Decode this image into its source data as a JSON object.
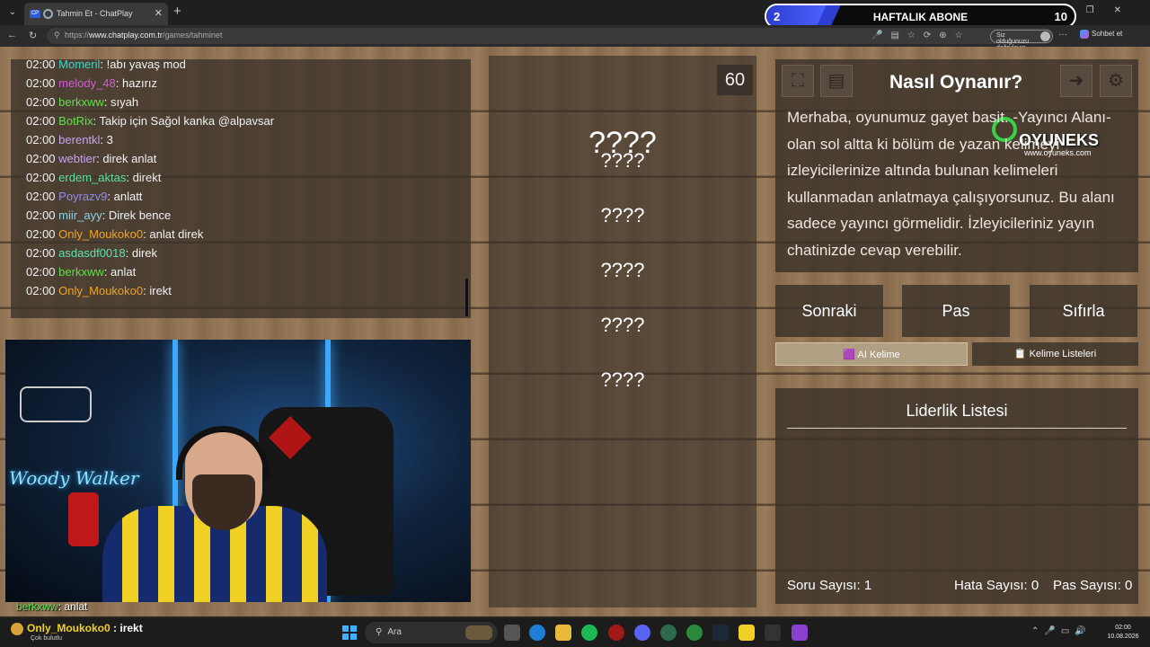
{
  "browser": {
    "tab_title": "Tahmin Et - ChatPlay",
    "url_prefix": "https://",
    "url_domain": "www.chatplay.com.tr",
    "url_path": "/games/tahminet",
    "verify_text": "Siz olduğunuzu doğrulayın",
    "copilot_label": "Sohbet et"
  },
  "subscription": {
    "current": "2",
    "label": "HAFTALIK ABONE",
    "goal": "10",
    "progress_fraction": 0.2
  },
  "chat": [
    {
      "time": "02:00",
      "user": "Momeril",
      "color": "#3fd6c5",
      "msg": "!abı yavaş mod"
    },
    {
      "time": "02:00",
      "user": "melody_48",
      "color": "#d25bd6",
      "msg": "hazırız"
    },
    {
      "time": "02:00",
      "user": "berkxww",
      "color": "#5fe04a",
      "msg": "sıyah"
    },
    {
      "time": "02:00",
      "user": "BotRix",
      "color": "#5fe04a",
      "msg": "Takip için Sağol kanka @alpavsar"
    },
    {
      "time": "02:00",
      "user": "berentkl",
      "color": "#c9a2f0",
      "msg": "3"
    },
    {
      "time": "02:00",
      "user": "webtier",
      "color": "#c9a2f0",
      "msg": "direk anlat"
    },
    {
      "time": "02:00",
      "user": "erdem_aktas",
      "color": "#5fe09a",
      "msg": "direkt"
    },
    {
      "time": "02:00",
      "user": "Poyrazv9",
      "color": "#8f8cf0",
      "msg": "anlatt"
    },
    {
      "time": "02:00",
      "user": "miir_ayy",
      "color": "#8fd0e8",
      "msg": "Direk bence"
    },
    {
      "time": "02:00",
      "user": "Only_Moukoko0",
      "color": "#f0a326",
      "msg": "anlat direk"
    },
    {
      "time": "02:00",
      "user": "asdasdf0018",
      "color": "#5fe0b0",
      "msg": "direk"
    },
    {
      "time": "02:00",
      "user": "berkxww",
      "color": "#5fe04a",
      "msg": "anlat"
    },
    {
      "time": "02:00",
      "user": "Only_Moukoko0",
      "color": "#f0a326",
      "msg": "irekt"
    }
  ],
  "stream_overlay": {
    "user": "berkxww",
    "msg": ": anlat",
    "neon_sign": "Woody Walker"
  },
  "game": {
    "timer": "60",
    "main_word": "????",
    "hidden_words": [
      "????",
      "????",
      "????",
      "????",
      "????"
    ]
  },
  "info": {
    "title": "Nasıl Oynanır?",
    "text": "Merhaba, oyunumuz gayet basit. -Yayıncı Alanı- olan sol altta ki bölüm de yazan kelimeyi izleyicilerinize altında bulunan kelimeleri kullanmadan anlatmaya çalışıyorsunuz. Bu alanı sadece yayıncı görmelidir. İzleyicileriniz yayın chatinizde cevap verebilir.",
    "logo_text": "OYUNEKS",
    "logo_url": "www.oyuneks.com"
  },
  "actions": {
    "next": "Sonraki",
    "pass": "Pas",
    "reset": "Sıfırla",
    "ai_word": "🟪 AI Kelime",
    "word_lists": "📋 Kelime Listeleri"
  },
  "leaderboard": {
    "title": "Liderlik Listesi",
    "question_count": "Soru Sayısı: 1",
    "error_count": "Hata Sayısı: 0",
    "pass_count": "Pas Sayısı: 0"
  },
  "taskbar": {
    "notify_user": "Only_Moukoko0",
    "notify_msg": ": irekt",
    "notify_sub": "Çok bulutlu",
    "search_placeholder": "Ara",
    "time": "02:00",
    "date": "10.08.2026"
  }
}
